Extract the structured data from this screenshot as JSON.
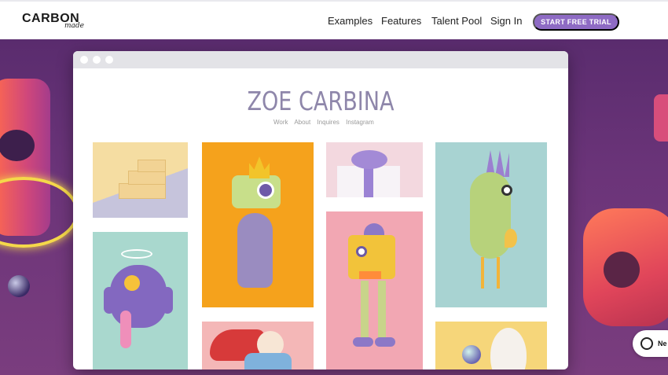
{
  "brand": {
    "name": "CARBON",
    "sub": "made"
  },
  "nav": {
    "examples": "Examples",
    "features": "Features",
    "talent_pool": "Talent Pool",
    "sign_in": "Sign In",
    "cta": "START FREE TRIAL"
  },
  "portfolio": {
    "title": "ZOE CARBINA",
    "links": [
      "Work",
      "About",
      "Inquires",
      "Instagram"
    ]
  },
  "chat": {
    "label": "Ne"
  },
  "colors": {
    "cta": "#8e6bc4",
    "hero_bg": "#6b3479",
    "title": "#8e86aa"
  }
}
